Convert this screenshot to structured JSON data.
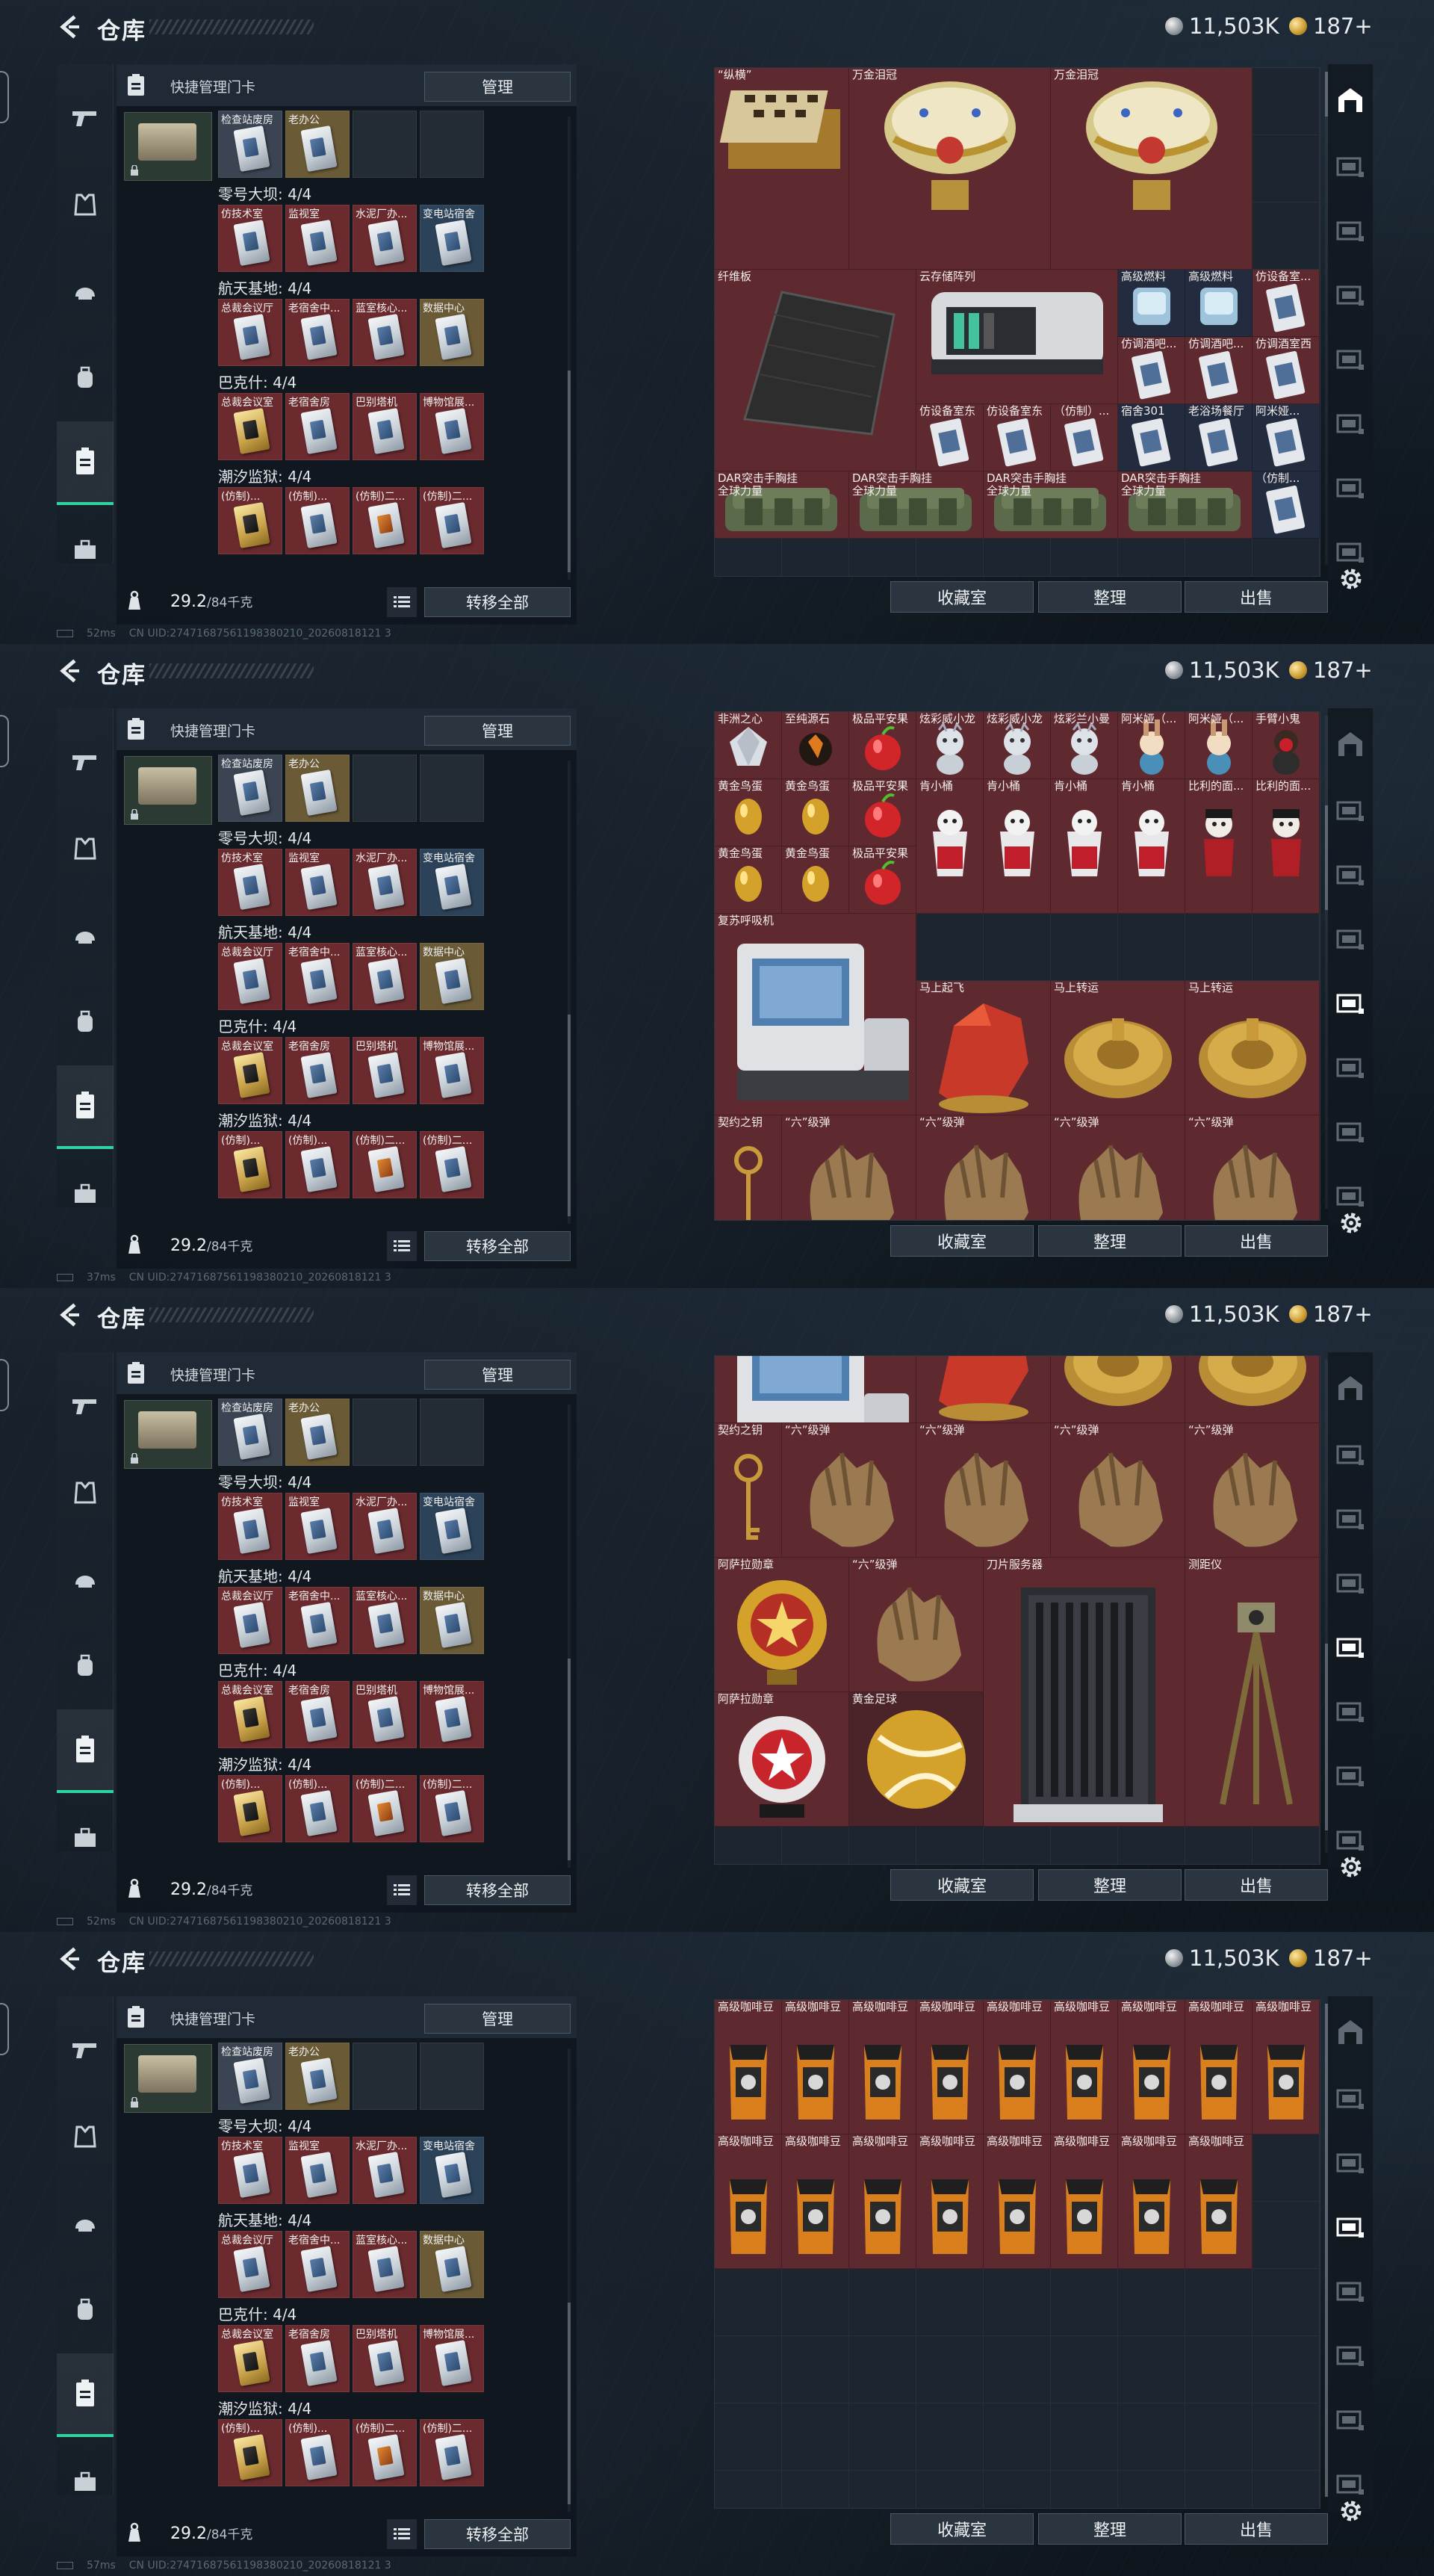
{
  "screens": [
    {
      "header": {
        "title": "仓库",
        "silver": "11,503K",
        "gold": "187+"
      },
      "left_panel": {
        "title": "快捷管理门卡",
        "manage_label": "管理",
        "sections": [
          {
            "cells": [
              "检查站废房",
              "老办公",
              "",
              ""
            ]
          },
          {
            "label": "零号大坝: 4/4",
            "cells": [
              "仿技术室",
              "监视室",
              "水泥厂办...",
              "变电站宿舍"
            ]
          },
          {
            "label": "航天基地: 4/4",
            "cells": [
              "总裁会议厅",
              "老宿舍中...",
              "蓝室核心...",
              "数据中心"
            ]
          },
          {
            "label": "巴克什: 4/4",
            "cells": [
              "总裁会议室",
              "老宿舍房",
              "巴别塔机",
              "博物馆展..."
            ]
          },
          {
            "label": "潮汐监狱: 4/4",
            "cells": [
              "(仿制)...",
              "(仿制)...",
              "(仿制)二...",
              "(仿制)二..."
            ]
          }
        ],
        "weight": "29.2",
        "weight_unit": "/84千克",
        "transfer_label": "转移全部"
      },
      "status": {
        "ping": "52ms",
        "uid": "CN UID:27471687561198380210_20260818121 3"
      },
      "right_panel": {
        "buttons": [
          "收藏室",
          "整理",
          "出售"
        ],
        "items": [
          {
            "label": "“纵横”"
          },
          {
            "label": "万金泪冠"
          },
          {
            "label": "万金泪冠"
          },
          {
            "label": "纤维板"
          },
          {
            "label": "云存储阵列"
          },
          {
            "label": "高级燃料"
          },
          {
            "label": "高级燃料"
          },
          {
            "label": "仿设备室..."
          },
          {
            "label": "仿调酒吧..."
          },
          {
            "label": "仿调酒吧..."
          },
          {
            "label": "仿调酒室西"
          },
          {
            "label": "仿设备室东"
          },
          {
            "label": "仿设备室东"
          },
          {
            "label": "（仿制）..."
          },
          {
            "label": "宿舍301"
          },
          {
            "label": "老浴场餐厅"
          },
          {
            "label": "阿米娅..."
          },
          {
            "label": "DAR突击手胸挂\n全球力量"
          },
          {
            "label": "DAR突击手胸挂\n全球力量"
          },
          {
            "label": "DAR突击手胸挂\n全球力量"
          },
          {
            "label": "DAR突击手胸挂\n全球力量"
          },
          {
            "label": "（仿制..."
          }
        ]
      }
    },
    {
      "header": {
        "title": "仓库",
        "silver": "11,503K",
        "gold": "187+"
      },
      "left_panel": {
        "title": "快捷管理门卡",
        "manage_label": "管理",
        "sections": [
          {
            "cells": [
              "检查站废房",
              "老办公",
              "",
              ""
            ]
          },
          {
            "label": "零号大坝: 4/4",
            "cells": [
              "仿技术室",
              "监视室",
              "水泥厂办...",
              "变电站宿舍"
            ]
          },
          {
            "label": "航天基地: 4/4",
            "cells": [
              "总裁会议厅",
              "老宿舍中...",
              "蓝室核心...",
              "数据中心"
            ]
          },
          {
            "label": "巴克什: 4/4",
            "cells": [
              "总裁会议室",
              "老宿舍房",
              "巴别塔机",
              "博物馆展..."
            ]
          },
          {
            "label": "潮汐监狱: 4/4",
            "cells": [
              "(仿制)...",
              "(仿制)...",
              "(仿制)二...",
              "(仿制)二..."
            ]
          }
        ],
        "weight": "29.2",
        "weight_unit": "/84千克",
        "transfer_label": "转移全部"
      },
      "status": {
        "ping": "37ms",
        "uid": "CN UID:27471687561198380210_20260818121 3"
      },
      "right_panel": {
        "buttons": [
          "收藏室",
          "整理",
          "出售"
        ],
        "items": [
          {
            "label": "非洲之心"
          },
          {
            "label": "至纯源石"
          },
          {
            "label": "极品平安果"
          },
          {
            "label": "炫彩威小龙"
          },
          {
            "label": "炫彩威小龙"
          },
          {
            "label": "炫彩兰小曼"
          },
          {
            "label": "阿米娅（..."
          },
          {
            "label": "阿米娅（..."
          },
          {
            "label": "手臂小鬼"
          },
          {
            "label": "黄金鸟蛋"
          },
          {
            "label": "黄金鸟蛋"
          },
          {
            "label": "极品平安果"
          },
          {
            "label": "黄金鸟蛋"
          },
          {
            "label": "黄金鸟蛋"
          },
          {
            "label": "极品平安果"
          },
          {
            "label": "肯小桶"
          },
          {
            "label": "肯小桶"
          },
          {
            "label": "肯小桶"
          },
          {
            "label": "肯小桶"
          },
          {
            "label": "比利的面..."
          },
          {
            "label": "比利的面..."
          },
          {
            "label": "复苏呼吸机"
          },
          {
            "label": "马上起飞"
          },
          {
            "label": "马上转运"
          },
          {
            "label": "马上转运"
          },
          {
            "label": "契约之钥"
          },
          {
            "label": "“六”级弹"
          },
          {
            "label": "“六”级弹"
          },
          {
            "label": "“六”级弹"
          },
          {
            "label": "“六”级弹"
          }
        ]
      }
    },
    {
      "header": {
        "title": "仓库",
        "silver": "11,503K",
        "gold": "187+"
      },
      "left_panel": {
        "title": "快捷管理门卡",
        "manage_label": "管理",
        "sections": [
          {
            "cells": [
              "检查站废房",
              "老办公",
              "",
              ""
            ]
          },
          {
            "label": "零号大坝: 4/4",
            "cells": [
              "仿技术室",
              "监视室",
              "水泥厂办...",
              "变电站宿舍"
            ]
          },
          {
            "label": "航天基地: 4/4",
            "cells": [
              "总裁会议厅",
              "老宿舍中...",
              "蓝室核心...",
              "数据中心"
            ]
          },
          {
            "label": "巴克什: 4/4",
            "cells": [
              "总裁会议室",
              "老宿舍房",
              "巴别塔机",
              "博物馆展..."
            ]
          },
          {
            "label": "潮汐监狱: 4/4",
            "cells": [
              "(仿制)...",
              "(仿制)...",
              "(仿制)二...",
              "(仿制)二..."
            ]
          }
        ],
        "weight": "29.2",
        "weight_unit": "/84千克",
        "transfer_label": "转移全部"
      },
      "status": {
        "ping": "52ms",
        "uid": "CN UID:27471687561198380210_20260818121 3"
      },
      "right_panel": {
        "buttons": [
          "收藏室",
          "整理",
          "出售"
        ],
        "items": [
          {
            "label": ""
          },
          {
            "label": ""
          },
          {
            "label": ""
          },
          {
            "label": ""
          },
          {
            "label": "契约之钥"
          },
          {
            "label": "“六”级弹"
          },
          {
            "label": "“六”级弹"
          },
          {
            "label": "“六”级弹"
          },
          {
            "label": "“六”级弹"
          },
          {
            "label": "阿萨拉勋章"
          },
          {
            "label": "“六”级弹"
          },
          {
            "label": "刀片服务器"
          },
          {
            "label": "测距仪"
          },
          {
            "label": "阿萨拉勋章"
          },
          {
            "label": "黄金足球"
          }
        ]
      }
    },
    {
      "header": {
        "title": "仓库",
        "silver": "11,503K",
        "gold": "187+"
      },
      "left_panel": {
        "title": "快捷管理门卡",
        "manage_label": "管理",
        "sections": [
          {
            "cells": [
              "检查站废房",
              "老办公",
              "",
              ""
            ]
          },
          {
            "label": "零号大坝: 4/4",
            "cells": [
              "仿技术室",
              "监视室",
              "水泥厂办...",
              "变电站宿舍"
            ]
          },
          {
            "label": "航天基地: 4/4",
            "cells": [
              "总裁会议厅",
              "老宿舍中...",
              "蓝室核心...",
              "数据中心"
            ]
          },
          {
            "label": "巴克什: 4/4",
            "cells": [
              "总裁会议室",
              "老宿舍房",
              "巴别塔机",
              "博物馆展..."
            ]
          },
          {
            "label": "潮汐监狱: 4/4",
            "cells": [
              "(仿制)...",
              "(仿制)...",
              "(仿制)二...",
              "(仿制)二..."
            ]
          }
        ],
        "weight": "29.2",
        "weight_unit": "/84千克",
        "transfer_label": "转移全部"
      },
      "status": {
        "ping": "57ms",
        "uid": "CN UID:27471687561198380210_20260818121 3"
      },
      "right_panel": {
        "buttons": [
          "收藏室",
          "整理",
          "出售"
        ],
        "items": [
          {
            "label": "高级咖啡豆"
          },
          {
            "label": "高级咖啡豆"
          },
          {
            "label": "高级咖啡豆"
          },
          {
            "label": "高级咖啡豆"
          },
          {
            "label": "高级咖啡豆"
          },
          {
            "label": "高级咖啡豆"
          },
          {
            "label": "高级咖啡豆"
          },
          {
            "label": "高级咖啡豆"
          },
          {
            "label": "高级咖啡豆"
          },
          {
            "label": "高级咖啡豆"
          },
          {
            "label": "高级咖啡豆"
          },
          {
            "label": "高级咖啡豆"
          },
          {
            "label": "高级咖啡豆"
          },
          {
            "label": "高级咖啡豆"
          },
          {
            "label": "高级咖啡豆"
          },
          {
            "label": "高级咖啡豆"
          },
          {
            "label": "高级咖啡豆"
          }
        ]
      }
    }
  ],
  "icons": {
    "back": "back-arrow-icon",
    "silver": "silver-coin-icon",
    "gold": "gold-coin-icon",
    "nav": [
      "pistol-icon",
      "armor-icon",
      "helmet-icon",
      "backpack-icon",
      "keycard-holder-icon",
      "briefcase-icon"
    ],
    "sidebar": [
      "vault-icon",
      "tv-icon",
      "tv-icon",
      "tv-icon",
      "tv-icon",
      "tv-icon",
      "tv-icon",
      "tv-icon"
    ],
    "settings": "gear-icon",
    "lock": "lock-icon",
    "list": "list-icon"
  },
  "colors": {
    "accent": "#2fd3a0",
    "item_bg": "#5e2a30",
    "panel": "#1a232c"
  }
}
